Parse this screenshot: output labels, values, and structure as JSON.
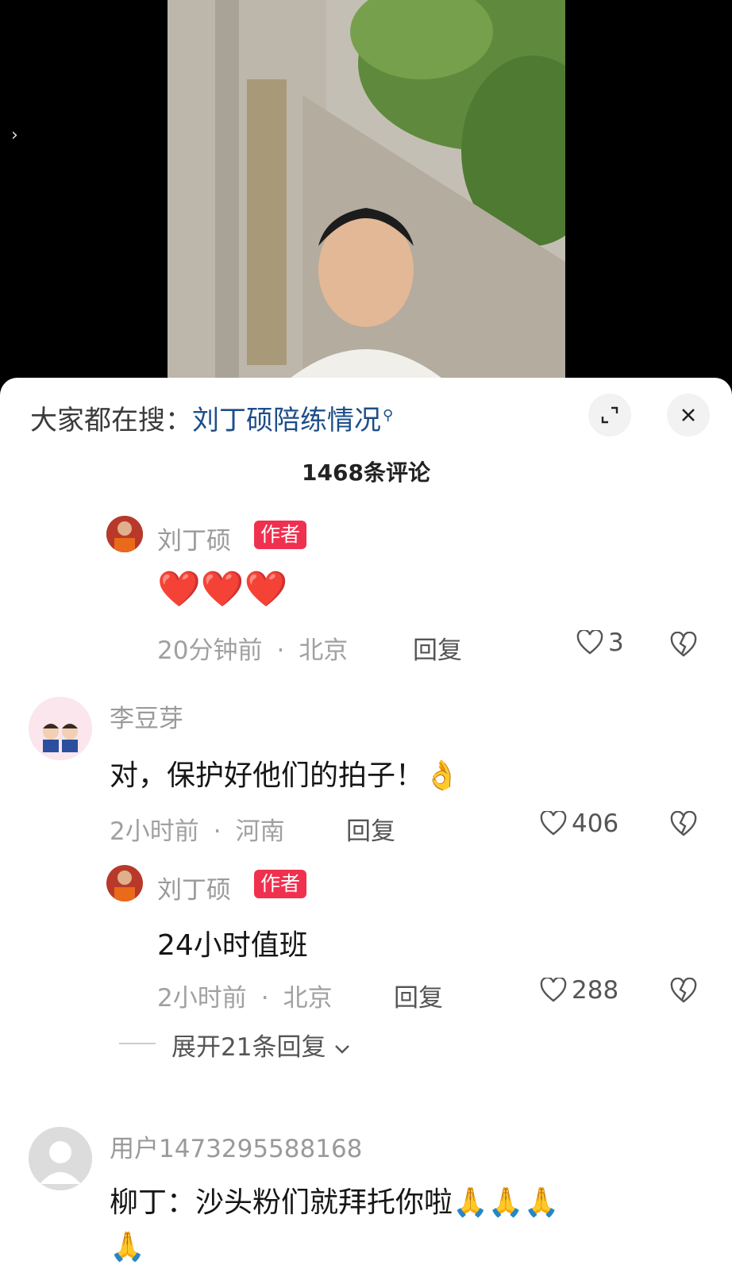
{
  "search": {
    "prefix": "大家都在搜：",
    "term": "刘丁硕陪练情况",
    "mag_glyph": "⚲"
  },
  "comment_count": "1468条评论",
  "icons": {
    "expand": "expand-icon",
    "close": "close-icon",
    "heart": "heart-icon",
    "dislike": "broken-heart-icon",
    "chevron": "chevron-down-icon",
    "side_arrow": "chevron-right-icon"
  },
  "colors": {
    "badge": "#f0304f",
    "search_term": "#1d4e89"
  },
  "comments": [
    {
      "user": "刘丁硕",
      "badge": "作者",
      "text": "❤️❤️❤️",
      "time": "20分钟前",
      "location": "北京",
      "reply": "回复",
      "likes": "3"
    },
    {
      "user": "李豆芽",
      "text": "对，保护好他们的拍子！👌",
      "time": "2小时前",
      "location": "河南",
      "reply": "回复",
      "likes": "406"
    },
    {
      "user": "刘丁硕",
      "badge": "作者",
      "text": "24小时值班",
      "time": "2小时前",
      "location": "北京",
      "reply": "回复",
      "likes": "288"
    },
    {
      "user": "用户1473295588168",
      "text": "柳丁：沙头粉们就拜托你啦🙏🙏🙏",
      "text2": "🙏"
    }
  ],
  "expand_replies": "展开21条回复"
}
